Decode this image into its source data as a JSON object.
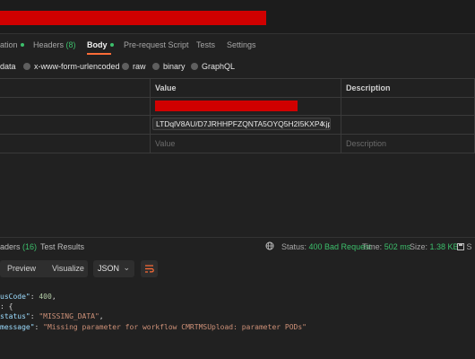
{
  "request_tabs": {
    "authorization_partial": "ation",
    "headers_label": "Headers",
    "headers_count": "(8)",
    "body_label": "Body",
    "prerequest_label": "Pre-request Script",
    "tests_label": "Tests",
    "settings_label": "Settings"
  },
  "body_modes": {
    "form_data_partial": "data",
    "urlencoded": "x-www-form-urlencoded",
    "raw": "raw",
    "binary": "binary",
    "graphql": "GraphQL"
  },
  "table": {
    "headers": [
      "Value",
      "Description"
    ],
    "file_value": "LTDqlV8AU/D7JRHHPFZQNTA5OYQ5H2I5KXP4.jpg",
    "value_placeholder": "Value",
    "description_placeholder": "Description"
  },
  "response": {
    "headers_partial": "aders",
    "headers_count": "(16)",
    "test_results": "Test Results",
    "status_label": "Status:",
    "status_value": "400 Bad Request",
    "time_label": "Time:",
    "time_value": "502 ms",
    "size_label": "Size:",
    "size_value": "1.38 KB",
    "save_partial": "S",
    "view_preview": "Preview",
    "view_visualize": "Visualize",
    "format": "JSON"
  },
  "response_body": {
    "line1_key": "usCode\"",
    "line1_value": "400",
    "line2": ": {",
    "line3_key": "status\"",
    "line3_value": "\"MISSING_DATA\"",
    "line4_key": "message\"",
    "line4_value": "\"Missing parameter for workflow CMRTMSUpload: parameter PODs\""
  },
  "colors": {
    "accent": "#ff6c37",
    "success": "#3cbf6b",
    "redaction": "#d00000"
  }
}
